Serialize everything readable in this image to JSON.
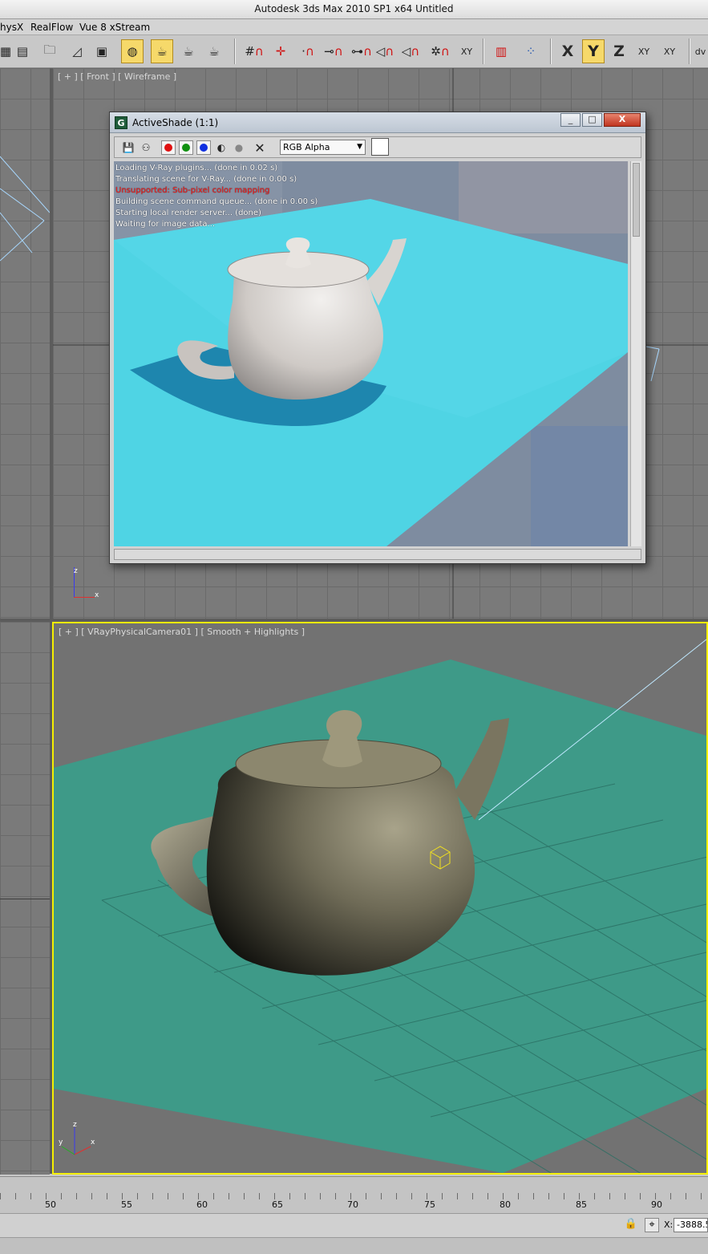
{
  "window": {
    "title": "Autodesk 3ds Max  2010 SP1 x64        Untitled"
  },
  "menu": [
    "hysX",
    "RealFlow",
    "Vue 8 xStream"
  ],
  "toolbar": {
    "axis_x": "X",
    "axis_y": "Y",
    "axis_z": "Z",
    "axis_xy": "XY",
    "axis_xy2": "XY",
    "snap_xy": "XY",
    "trailing": "dv"
  },
  "viewports": {
    "front_label": "[ + ] [ Front ] [ Wireframe ]",
    "camera_label": "[ + ] [ VRayPhysicalCamera01 ] [ Smooth + Highlights ]",
    "axis_z": "z",
    "axis_x": "x",
    "axis_y": "y"
  },
  "activeshade": {
    "title": "ActiveShade (1:1)",
    "app_icon": "G",
    "min": "_",
    "max": "□",
    "close": "X",
    "channel": "RGB Alpha",
    "log": [
      "Loading V-Ray plugins... (done in 0.02 s)",
      "Translating scene for V-Ray... (done in 0.00 s)",
      "Unsupported: Sub-pixel color mapping",
      "Building scene command queue... (done in 0.00 s)",
      "Starting local render server... (done)",
      "Waiting for image data..."
    ]
  },
  "timeline": {
    "ticks": [
      "50",
      "55",
      "60",
      "65",
      "70",
      "75",
      "80",
      "85",
      "90"
    ]
  },
  "status": {
    "x_label": "X:",
    "x_value": "-3888.5"
  }
}
